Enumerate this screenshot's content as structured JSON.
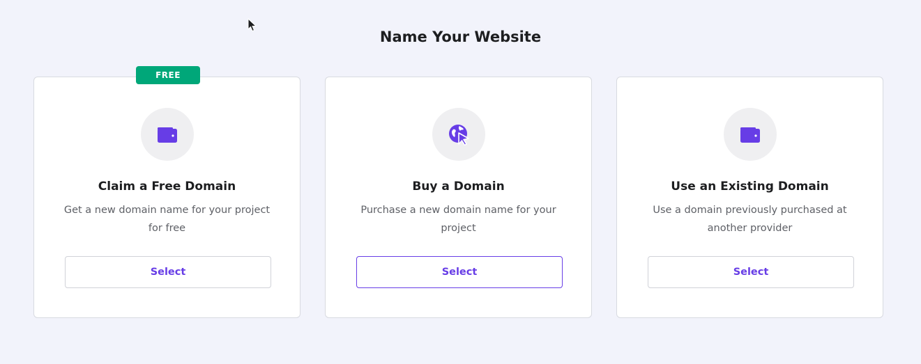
{
  "page": {
    "title": "Name Your Website"
  },
  "colors": {
    "accent": "#673de6",
    "badge": "#00a779",
    "background": "#f2f3fb"
  },
  "cards": [
    {
      "badge": "FREE",
      "icon": "wallet-icon",
      "title": "Claim a Free Domain",
      "description": "Get a new domain name for your project for free",
      "button": "Select"
    },
    {
      "icon": "globe-cursor-icon",
      "title": "Buy a Domain",
      "description": "Purchase a new domain name for your project",
      "button": "Select"
    },
    {
      "icon": "wallet-icon",
      "title": "Use an Existing Domain",
      "description": "Use a domain previously purchased at another provider",
      "button": "Select"
    }
  ]
}
